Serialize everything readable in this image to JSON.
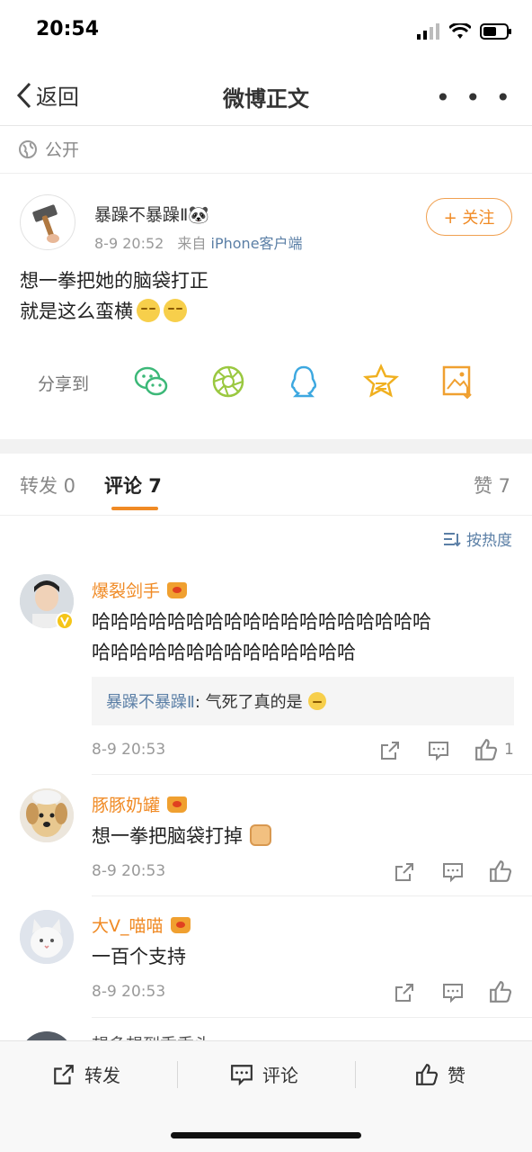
{
  "status_bar": {
    "time": "20:54"
  },
  "nav": {
    "back_label": "返回",
    "title": "微博正文",
    "more": "• • •"
  },
  "visibility": "公开",
  "post": {
    "author": "暴躁不暴躁Ⅱ🐼",
    "time": "8-9 20:52",
    "source_prefix": "来自",
    "source": "iPhone客户端",
    "follow_label": "+ 关注",
    "line1": "想一拳把她的脑袋打正",
    "line2": "就是这么蛮横"
  },
  "share": {
    "label": "分享到",
    "icons": [
      "wechat-icon",
      "moments-icon",
      "qq-icon",
      "qzone-icon",
      "save-image-icon"
    ]
  },
  "tabs": {
    "repost": "转发 0",
    "comment": "评论 7",
    "like": "赞 7"
  },
  "sort_label": "按热度",
  "comments": [
    {
      "name": "爆裂剑手",
      "text1": "哈哈哈哈哈哈哈哈哈哈哈哈哈哈哈哈哈哈",
      "text2": "哈哈哈哈哈哈哈哈哈哈哈哈哈哈",
      "reply_name": "暴躁不暴躁Ⅱ",
      "reply_text": ": 气死了真的是",
      "time": "8-9 20:53",
      "likes": "1"
    },
    {
      "name": "豚豚奶罐",
      "text1": "想一拳把脑袋打掉",
      "time": "8-9 20:53"
    },
    {
      "name": "大V_喵喵",
      "text1": "一百个支持",
      "time": "8-9 20:53"
    },
    {
      "name": "想多想到秃秃头"
    }
  ],
  "bottom_bar": {
    "repost": "转发",
    "comment": "评论",
    "like": "赞"
  },
  "colors": {
    "accent": "#f08a24",
    "link": "#5b7fa6"
  }
}
